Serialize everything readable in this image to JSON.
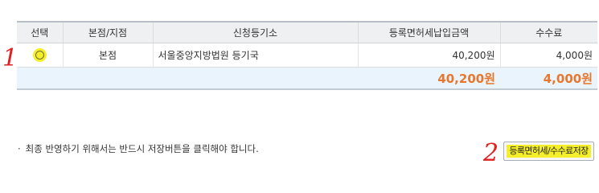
{
  "table": {
    "headers": {
      "select": "선택",
      "branch": "본점/지점",
      "office": "신청등기소",
      "tax_amount": "등록면허세납입금액",
      "fee": "수수료"
    },
    "rows": [
      {
        "branch": "본점",
        "office": "서울중앙지방법원 등기국",
        "tax_amount": "40,200원",
        "fee": "4,000원"
      }
    ],
    "total": {
      "tax_amount": "40,200원",
      "fee": "4,000원"
    }
  },
  "annotations": {
    "marker_1": "1",
    "marker_2": "2"
  },
  "notice": {
    "bullet": "·",
    "text": "최종 반영하기 위해서는 반드시 저장버튼을 클릭해야 합니다."
  },
  "buttons": {
    "save_label": "등록면허세/수수료저장"
  },
  "colors": {
    "highlight": "#f4ef2a",
    "total_text": "#e8772e",
    "total_row_bg": "#e9f4fc",
    "annotation": "#e02020"
  }
}
